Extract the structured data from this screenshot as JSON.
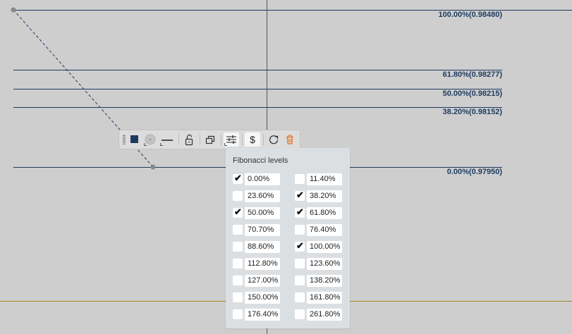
{
  "chart": {
    "fib_lines": [
      {
        "label": "100.00%(0.98480)",
        "price": 0.9848
      },
      {
        "label": "61.80%(0.98277)",
        "price": 0.98277
      },
      {
        "label": "50.00%(0.98215)",
        "price": 0.98215
      },
      {
        "label": "38.20%(0.98152)",
        "price": 0.98152
      },
      {
        "label": "0.00%(0.97950)",
        "price": 0.9795
      }
    ],
    "line_color": "#1d3a5e",
    "baseline_color": "#a08722",
    "crosshair_color": "#555555"
  },
  "toolbar": {
    "items": [
      {
        "name": "drag-handle-icon"
      },
      {
        "name": "line-color-swatch",
        "color": "#1d3a5e"
      },
      {
        "name": "fill-color-circle-icon"
      },
      {
        "name": "line-style-icon"
      },
      {
        "name": "lock-icon"
      },
      {
        "name": "clone-icon"
      },
      {
        "name": "settings-sliders-icon"
      },
      {
        "name": "dollar-icon",
        "glyph": "$"
      },
      {
        "name": "refresh-icon"
      },
      {
        "name": "trash-icon",
        "color": "#e07020"
      }
    ]
  },
  "fib_panel": {
    "title": "Fibonacci levels",
    "levels": [
      {
        "value": "0.00%",
        "checked": true
      },
      {
        "value": "11.40%",
        "checked": false
      },
      {
        "value": "23.60%",
        "checked": false
      },
      {
        "value": "38.20%",
        "checked": true
      },
      {
        "value": "50.00%",
        "checked": true
      },
      {
        "value": "61.80%",
        "checked": true
      },
      {
        "value": "70.70%",
        "checked": false
      },
      {
        "value": "76.40%",
        "checked": false
      },
      {
        "value": "88.60%",
        "checked": false
      },
      {
        "value": "100.00%",
        "checked": true
      },
      {
        "value": "112.80%",
        "checked": false
      },
      {
        "value": "123.60%",
        "checked": false
      },
      {
        "value": "127.00%",
        "checked": false
      },
      {
        "value": "138.20%",
        "checked": false
      },
      {
        "value": "150.00%",
        "checked": false
      },
      {
        "value": "161.80%",
        "checked": false
      },
      {
        "value": "176.40%",
        "checked": false
      },
      {
        "value": "261.80%",
        "checked": false
      }
    ]
  }
}
